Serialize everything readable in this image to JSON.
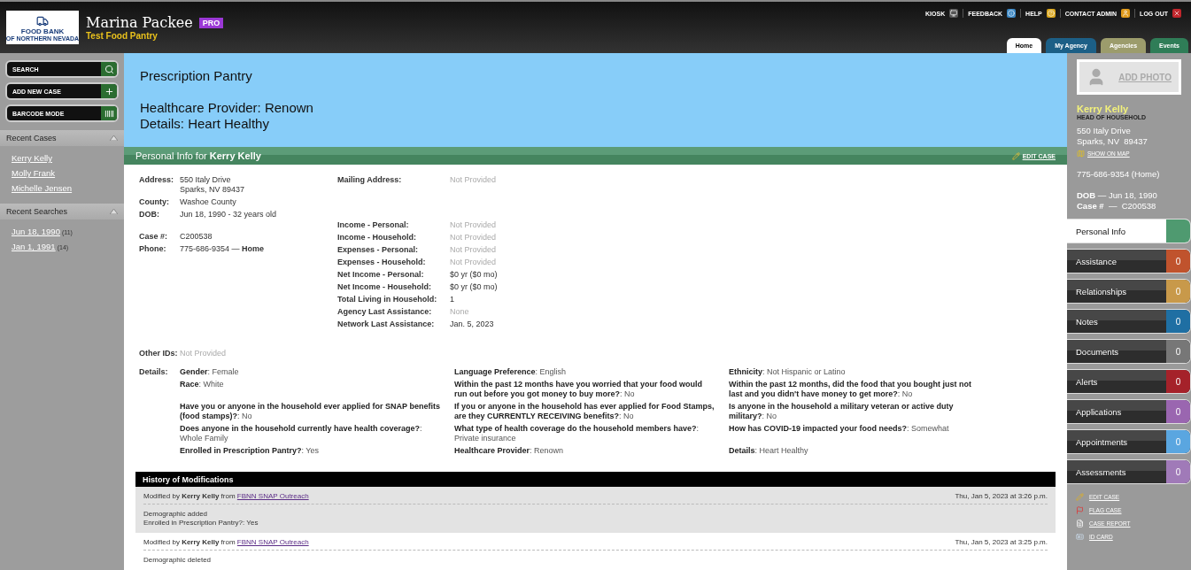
{
  "header": {
    "logo": {
      "title": "FOOD BANK",
      "subtitle": "OF NORTHERN NEVADA"
    },
    "user_name": "Marina Packee",
    "badge": "PRO",
    "agency": "Test Food Pantry",
    "top_links": [
      {
        "label": "KIOSK",
        "kind": "kiosk"
      },
      {
        "label": "FEEDBACK",
        "kind": "feedback"
      },
      {
        "label": "HELP",
        "kind": "help"
      },
      {
        "label": "CONTACT ADMIN",
        "kind": "contact"
      },
      {
        "label": "LOG OUT",
        "kind": "logout"
      }
    ],
    "tabs": [
      {
        "label": "Home",
        "selected": true
      },
      {
        "label": "My Agency",
        "selected": false,
        "color": "#1c5f86"
      },
      {
        "label": "Agencies",
        "selected": false,
        "color": "#9c9c6c"
      },
      {
        "label": "Events",
        "selected": false,
        "color": "#2f7d57"
      }
    ]
  },
  "left_sidebar": {
    "buttons": [
      {
        "label": "SEARCH",
        "kind": "search"
      },
      {
        "label": "ADD NEW CASE",
        "kind": "add"
      },
      {
        "label": "BARCODE MODE",
        "kind": "barcode"
      }
    ],
    "sections": [
      {
        "title": "Recent Cases",
        "expanded": true,
        "items": [
          {
            "label": "Kerry Kelly"
          },
          {
            "label": "Molly Frank"
          },
          {
            "label": "Michelle Jensen"
          }
        ]
      },
      {
        "title": "Recent Searches",
        "expanded": true,
        "items": [
          {
            "label": "Jun 18, 1990",
            "count": "(11)"
          },
          {
            "label": "Jan 1, 1991",
            "count": "(14)"
          }
        ]
      }
    ]
  },
  "banner": {
    "title": "Prescription Pantry",
    "lines": [
      "Healthcare Provider: Renown",
      "Details: Heart Healthy"
    ]
  },
  "personal_info": {
    "title": "Personal Info for",
    "name": "Kerry Kelly",
    "edit_link": "EDIT CASE",
    "left_groups": [
      [
        {
          "label": "Address:",
          "lines": [
            "550 Italy Drive",
            "Sparks, NV 89437"
          ],
          "muted": false
        },
        {
          "label": "County:",
          "lines": [
            "Washoe County"
          ],
          "muted": false
        },
        {
          "label": "DOB:",
          "lines": [
            "Jun 18, 1990 - 32 years old"
          ],
          "muted": false
        }
      ],
      [
        {
          "label": "Case #:",
          "lines": [
            "C200538"
          ],
          "muted": false
        },
        {
          "label": "Phone:",
          "lines": [
            "775-686-9354 — **Home**"
          ],
          "muted": false
        }
      ]
    ],
    "right_groups": [
      [
        {
          "label": "Mailing Address:",
          "lines": [
            "Not Provided"
          ],
          "muted": true
        }
      ],
      [
        {
          "label": "Income - Personal:",
          "lines": [
            "Not Provided"
          ],
          "muted": true
        },
        {
          "label": "Income - Household:",
          "lines": [
            "Not Provided"
          ],
          "muted": true
        },
        {
          "label": "Expenses - Personal:",
          "lines": [
            "Not Provided"
          ],
          "muted": true
        },
        {
          "label": "Expenses - Household:",
          "lines": [
            "Not Provided"
          ],
          "muted": true
        },
        {
          "label": "Net Income - Personal:",
          "lines": [
            "$0 yr ($0 mo)"
          ],
          "muted": false
        },
        {
          "label": "Net Income - Household:",
          "lines": [
            "$0 yr ($0 mo)"
          ],
          "muted": false
        },
        {
          "label": "Total Living in Household:",
          "lines": [
            "1"
          ],
          "muted": false
        },
        {
          "label": "Agency Last Assistance:",
          "lines": [
            "None"
          ],
          "muted": true
        },
        {
          "label": "Network Last Assistance:",
          "lines": [
            "Jan. 5, 2023"
          ],
          "muted": false
        }
      ]
    ],
    "other_ids": {
      "label": "Other IDs:",
      "value": "Not Provided",
      "muted": true
    },
    "details": {
      "label": "Details:",
      "rows": [
        [
          "**Gender**: Female",
          "**Language Preference**: English",
          "**Ethnicity**: Not Hispanic or Latino"
        ],
        [
          "**Race**: White",
          "**Within the past 12 months have you worried that your food would run out before you got money to buy more?**: No",
          "**Within the past 12 months, did the food that you bought just not last and you didn't have money to get more?**: No"
        ],
        [
          "**Have you or anyone in the household ever applied for SNAP benefits (food stamps)?**: No",
          "**If you or anyone in the household has ever applied for Food Stamps, are they CURRENTLY RECEIVING benefits?**: No",
          "**Is anyone in the household a military veteran or active duty military?**: No"
        ],
        [
          "**Does anyone in the household currently have health coverage?**: Whole Family",
          "**What type of health coverage do the household members have?**: Private insurance",
          "**How has COVID-19 impacted your food needs?**: Somewhat"
        ],
        [
          "**Enrolled in Prescription Pantry?**: Yes",
          "**Healthcare Provider**: Renown",
          "**Details**: Heart Healthy"
        ]
      ]
    }
  },
  "history": {
    "title": "History of Modifications",
    "entries": [
      {
        "text": "Modified by **Kerry Kelly** from",
        "agency": "FBNN SNAP Outreach",
        "date": "Thu, Jan 5, 2023 at 3:26 p.m.",
        "lines": [
          "Demographic added",
          "Enrolled in Prescription Pantry?: Yes"
        ]
      },
      {
        "text": "Modified by **Kerry Kelly** from",
        "agency": "FBNN SNAP Outreach",
        "date": "Thu, Jan 5, 2023 at 3:25 p.m.",
        "lines": [
          "Demographic deleted"
        ]
      }
    ]
  },
  "right_sidebar": {
    "add_photo": "ADD PHOTO",
    "name": "Kerry Kelly",
    "role": "HEAD OF HOUSEHOLD",
    "address": [
      "550 Italy Drive",
      "Sparks, NV  89437"
    ],
    "map_link": "SHOW ON MAP",
    "phone": "775-686-9354 (Home)",
    "facts": [
      "**DOB** — Jun 18, 1990",
      "**Case #**  —  C200538"
    ],
    "nav": [
      {
        "label": "Personal Info",
        "color": "#4f9a70",
        "selected": true
      },
      {
        "label": "Assistance",
        "count": "0",
        "color": "#c0532d",
        "selected": false
      },
      {
        "label": "Relationships",
        "count": "0",
        "color": "#c8994a",
        "selected": false
      },
      {
        "label": "Notes",
        "count": "0",
        "color": "#1f6fa3",
        "selected": false
      },
      {
        "label": "Documents",
        "count": "0",
        "color": "#777777",
        "selected": false
      },
      {
        "label": "Alerts",
        "count": "0",
        "color": "#a5222a",
        "selected": false
      },
      {
        "label": "Applications",
        "count": "0",
        "color": "#9a66b0",
        "selected": false
      },
      {
        "label": "Appointments",
        "count": "0",
        "color": "#5aa6e0",
        "selected": false
      },
      {
        "label": "Assessments",
        "count": "0",
        "color": "#a07ab8",
        "selected": false
      }
    ],
    "actions": [
      {
        "label": "EDIT CASE",
        "kind": "edit"
      },
      {
        "label": "FLAG CASE",
        "kind": "flag"
      },
      {
        "label": "CASE REPORT",
        "kind": "report"
      },
      {
        "label": "ID CARD",
        "kind": "idcard"
      }
    ]
  }
}
